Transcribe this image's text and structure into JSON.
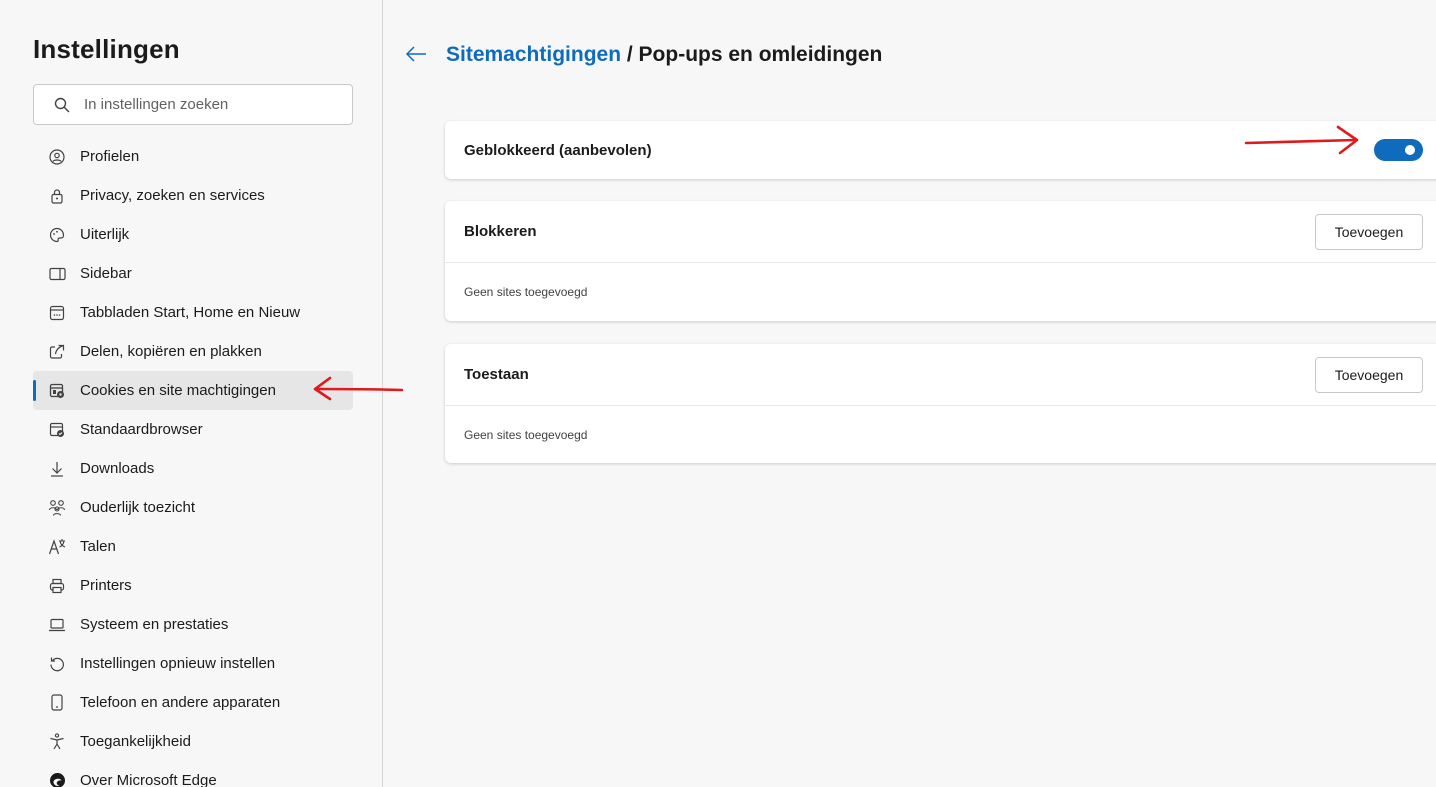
{
  "sidebar": {
    "title": "Instellingen",
    "search_placeholder": "In instellingen zoeken",
    "items": [
      {
        "label": "Profielen",
        "icon": "profile-icon"
      },
      {
        "label": "Privacy, zoeken en services",
        "icon": "lock-icon"
      },
      {
        "label": "Uiterlijk",
        "icon": "appearance-icon"
      },
      {
        "label": "Sidebar",
        "icon": "sidebar-icon"
      },
      {
        "label": "Tabbladen Start, Home en Nieuw",
        "icon": "new-tab-icon"
      },
      {
        "label": "Delen, kopiëren en plakken",
        "icon": "share-icon"
      },
      {
        "label": "Cookies en site machtigingen",
        "icon": "cookies-icon",
        "active": true
      },
      {
        "label": "Standaardbrowser",
        "icon": "default-browser-icon"
      },
      {
        "label": "Downloads",
        "icon": "download-icon"
      },
      {
        "label": "Ouderlijk toezicht",
        "icon": "family-icon"
      },
      {
        "label": "Talen",
        "icon": "languages-icon"
      },
      {
        "label": "Printers",
        "icon": "printer-icon"
      },
      {
        "label": "Systeem en prestaties",
        "icon": "laptop-icon"
      },
      {
        "label": "Instellingen opnieuw instellen",
        "icon": "reset-icon"
      },
      {
        "label": "Telefoon en andere apparaten",
        "icon": "phone-icon"
      },
      {
        "label": "Toegankelijkheid",
        "icon": "accessibility-icon"
      },
      {
        "label": "Over Microsoft Edge",
        "icon": "edge-logo-icon"
      }
    ]
  },
  "main": {
    "breadcrumb_link": "Sitemachtigingen",
    "breadcrumb_separator": " / ",
    "breadcrumb_current": "Pop-ups en omleidingen",
    "blocked_label": "Geblokkeerd (aanbevolen)",
    "blocked_toggle_on": true,
    "block_section": {
      "title": "Blokkeren",
      "button": "Toevoegen",
      "empty": "Geen sites toegevoegd"
    },
    "allow_section": {
      "title": "Toestaan",
      "button": "Toevoegen",
      "empty": "Geen sites toegevoegd"
    }
  },
  "colors": {
    "accent": "#0f6cbd",
    "annotation": "#e0191e"
  }
}
